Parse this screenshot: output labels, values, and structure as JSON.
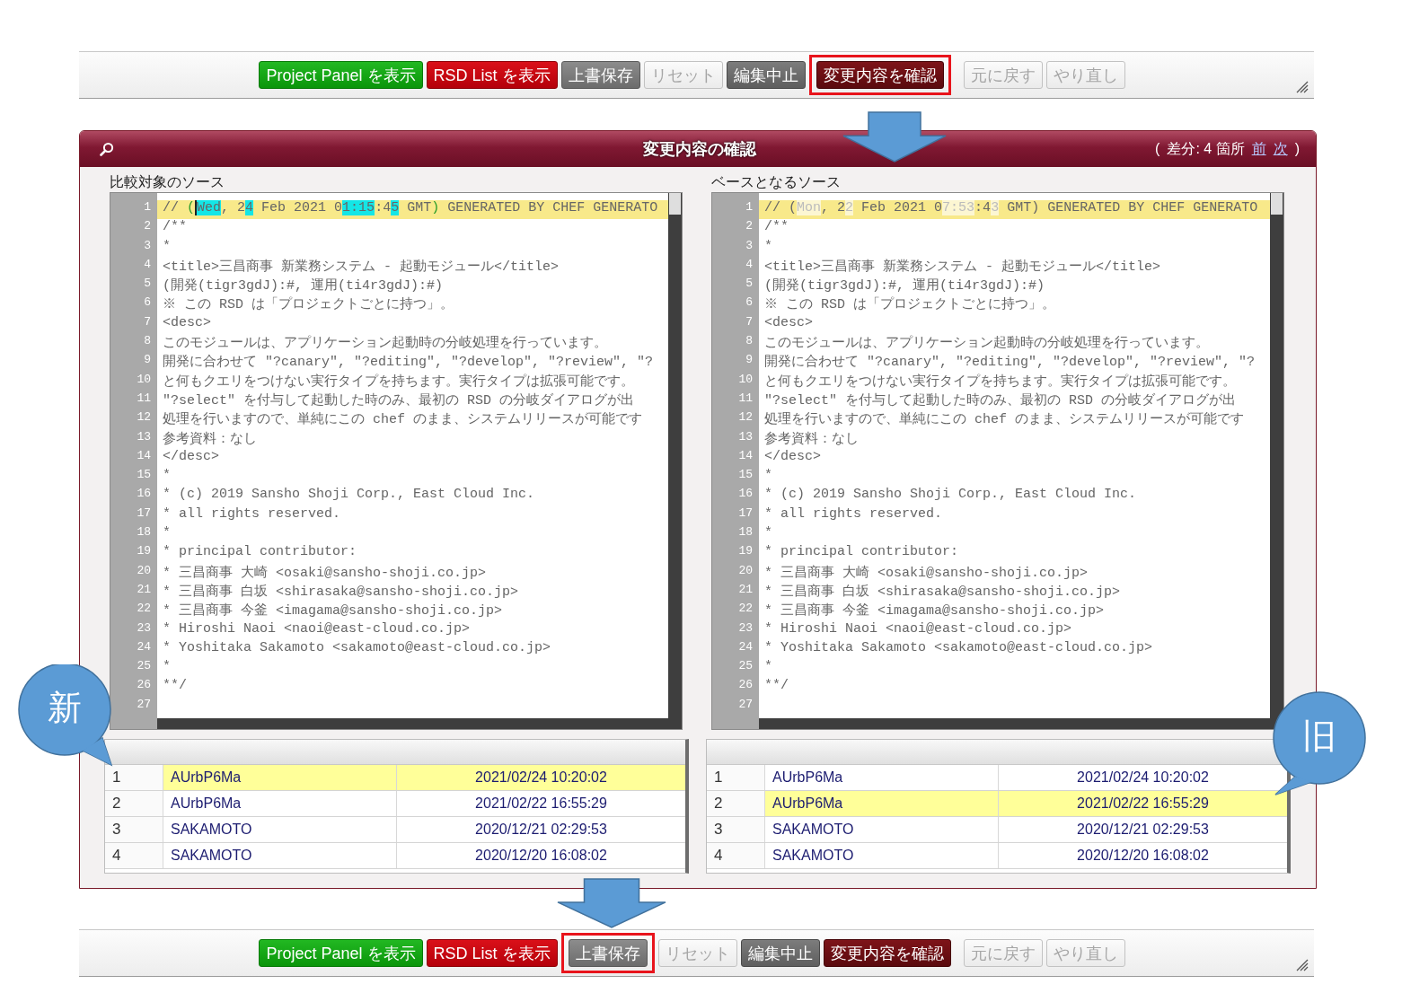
{
  "top_toolbar": {
    "groups": [
      {
        "buttons": [
          {
            "label": "Project Panel を表示",
            "kind": "success",
            "disabled": false,
            "highlighted": false
          },
          {
            "label": "RSD List を表示",
            "kind": "danger",
            "disabled": false,
            "highlighted": false
          },
          {
            "label": "上書保存",
            "kind": "secondary",
            "disabled": false,
            "highlighted": false
          },
          {
            "label": "リセット",
            "kind": "plain",
            "disabled": true,
            "highlighted": false
          },
          {
            "label": "編集中止",
            "kind": "dark",
            "disabled": false,
            "highlighted": false
          },
          {
            "label": "変更内容を確認",
            "kind": "maroon",
            "disabled": false,
            "highlighted": true
          }
        ]
      },
      {
        "buttons": [
          {
            "label": "元に戻す",
            "kind": "plain",
            "disabled": true,
            "highlighted": false
          },
          {
            "label": "やり直し",
            "kind": "plain",
            "disabled": true,
            "highlighted": false
          }
        ]
      }
    ]
  },
  "dialog": {
    "title": "変更内容の確認",
    "diff": {
      "open": "(",
      "count": "差分: 4 箇所",
      "prev": "前",
      "next": "次",
      "close": ")"
    },
    "panes": [
      {
        "label": "比較対象のソース",
        "lines": [
          {
            "number": "1",
            "changed": true,
            "segments": [
              {
                "text": "// ",
                "kind": "same",
                "caret": false
              },
              {
                "text": "(",
                "kind": "bracket",
                "caret": false
              },
              {
                "text": "Wed",
                "kind": "inserted",
                "caret": true
              },
              {
                "text": ", 2",
                "kind": "same",
                "caret": false
              },
              {
                "text": "4",
                "kind": "inserted",
                "caret": false
              },
              {
                "text": " Feb 2021 0",
                "kind": "same",
                "caret": false
              },
              {
                "text": "1:15",
                "kind": "inserted",
                "caret": false
              },
              {
                "text": ":4",
                "kind": "same",
                "caret": false
              },
              {
                "text": "5",
                "kind": "inserted",
                "caret": false
              },
              {
                "text": " GMT",
                "kind": "same",
                "caret": false
              },
              {
                "text": ")",
                "kind": "bracket",
                "caret": false
              },
              {
                "text": " GENERATED BY CHEF GENERATO",
                "kind": "same",
                "caret": false
              }
            ]
          },
          {
            "number": "2",
            "changed": false,
            "text": "/**"
          },
          {
            "number": "3",
            "changed": false,
            "text": "*"
          },
          {
            "number": "4",
            "changed": false,
            "text": "<title>三昌商事 新業務システム - 起動モジュール</title>"
          },
          {
            "number": "5",
            "changed": false,
            "text": "(開発(tigr3gdJ):#, 運用(ti4r3gdJ):#)"
          },
          {
            "number": "6",
            "changed": false,
            "text": "※ この RSD は「プロジェクトごとに持つ」。"
          },
          {
            "number": "7",
            "changed": false,
            "text": "<desc>"
          },
          {
            "number": "8",
            "changed": false,
            "text": "このモジュールは、アプリケーション起動時の分岐処理を行っています。"
          },
          {
            "number": "9",
            "changed": false,
            "text": "開発に合わせて \"?canary\", \"?editing\", \"?develop\", \"?review\", \"?"
          },
          {
            "number": "10",
            "changed": false,
            "text": "と何もクエリをつけない実行タイプを持ちます。実行タイプは拡張可能です。"
          },
          {
            "number": "11",
            "changed": false,
            "text": "\"?select\" を付与して起動した時のみ、最初の RSD の分岐ダイアログが出"
          },
          {
            "number": "12",
            "changed": false,
            "text": "処理を行いますので、単純にこの chef のまま、システムリリースが可能です"
          },
          {
            "number": "13",
            "changed": false,
            "text": "参考資料：なし"
          },
          {
            "number": "14",
            "changed": false,
            "text": "</desc>"
          },
          {
            "number": "15",
            "changed": false,
            "text": "*"
          },
          {
            "number": "16",
            "changed": false,
            "text": "* (c) 2019 Sansho Shoji Corp., East Cloud Inc."
          },
          {
            "number": "17",
            "changed": false,
            "text": "* all rights reserved."
          },
          {
            "number": "18",
            "changed": false,
            "text": "*"
          },
          {
            "number": "19",
            "changed": false,
            "text": "* principal contributor:"
          },
          {
            "number": "20",
            "changed": false,
            "text": "* 三昌商事 大崎 <osaki@sansho-shoji.co.jp>"
          },
          {
            "number": "21",
            "changed": false,
            "text": "* 三昌商事 白坂 <shirasaka@sansho-shoji.co.jp>"
          },
          {
            "number": "22",
            "changed": false,
            "text": "* 三昌商事 今釜 <imagama@sansho-shoji.co.jp>"
          },
          {
            "number": "23",
            "changed": false,
            "text": "* Hiroshi Naoi <naoi@east-cloud.co.jp>"
          },
          {
            "number": "24",
            "changed": false,
            "text": "* Yoshitaka Sakamoto <sakamoto@east-cloud.co.jp>"
          },
          {
            "number": "25",
            "changed": false,
            "text": "*"
          },
          {
            "number": "26",
            "changed": false,
            "text": "**/"
          },
          {
            "number": "27",
            "changed": false
          }
        ],
        "history": [
          {
            "number": "1",
            "user": "AUrbP6Ma",
            "date": "2021/02/24 10:20:02",
            "selected": true
          },
          {
            "number": "2",
            "user": "AUrbP6Ma",
            "date": "2021/02/22 16:55:29",
            "selected": false
          },
          {
            "number": "3",
            "user": "SAKAMOTO",
            "date": "2020/12/21 02:29:53",
            "selected": false
          },
          {
            "number": "4",
            "user": "SAKAMOTO",
            "date": "2020/12/20 16:08:02",
            "selected": false
          }
        ]
      },
      {
        "label": "ベースとなるソース",
        "lines": [
          {
            "number": "1",
            "changed": true,
            "segments": [
              {
                "text": "// (",
                "kind": "same",
                "caret": false
              },
              {
                "text": "Mon",
                "kind": "deleted",
                "caret": false
              },
              {
                "text": ", 2",
                "kind": "same",
                "caret": false
              },
              {
                "text": "2",
                "kind": "deleted",
                "caret": false
              },
              {
                "text": " Feb 2021 0",
                "kind": "same",
                "caret": false
              },
              {
                "text": "7:53",
                "kind": "deleted",
                "caret": false
              },
              {
                "text": ":4",
                "kind": "same",
                "caret": false
              },
              {
                "text": "3",
                "kind": "deleted",
                "caret": false
              },
              {
                "text": " GMT) GENERATED BY CHEF GENERATO",
                "kind": "same",
                "caret": false
              }
            ]
          },
          {
            "number": "2",
            "changed": false,
            "text": "/**"
          },
          {
            "number": "3",
            "changed": false,
            "text": "*"
          },
          {
            "number": "4",
            "changed": false,
            "text": "<title>三昌商事 新業務システム - 起動モジュール</title>"
          },
          {
            "number": "5",
            "changed": false,
            "text": "(開発(tigr3gdJ):#, 運用(ti4r3gdJ):#)"
          },
          {
            "number": "6",
            "changed": false,
            "text": "※ この RSD は「プロジェクトごとに持つ」。"
          },
          {
            "number": "7",
            "changed": false,
            "text": "<desc>"
          },
          {
            "number": "8",
            "changed": false,
            "text": "このモジュールは、アプリケーション起動時の分岐処理を行っています。"
          },
          {
            "number": "9",
            "changed": false,
            "text": "開発に合わせて \"?canary\", \"?editing\", \"?develop\", \"?review\", \"?"
          },
          {
            "number": "10",
            "changed": false,
            "text": "と何もクエリをつけない実行タイプを持ちます。実行タイプは拡張可能です。"
          },
          {
            "number": "11",
            "changed": false,
            "text": "\"?select\" を付与して起動した時のみ、最初の RSD の分岐ダイアログが出"
          },
          {
            "number": "12",
            "changed": false,
            "text": "処理を行いますので、単純にこの chef のまま、システムリリースが可能です"
          },
          {
            "number": "13",
            "changed": false,
            "text": "参考資料：なし"
          },
          {
            "number": "14",
            "changed": false,
            "text": "</desc>"
          },
          {
            "number": "15",
            "changed": false,
            "text": "*"
          },
          {
            "number": "16",
            "changed": false,
            "text": "* (c) 2019 Sansho Shoji Corp., East Cloud Inc."
          },
          {
            "number": "17",
            "changed": false,
            "text": "* all rights reserved."
          },
          {
            "number": "18",
            "changed": false,
            "text": "*"
          },
          {
            "number": "19",
            "changed": false,
            "text": "* principal contributor:"
          },
          {
            "number": "20",
            "changed": false,
            "text": "* 三昌商事 大崎 <osaki@sansho-shoji.co.jp>"
          },
          {
            "number": "21",
            "changed": false,
            "text": "* 三昌商事 白坂 <shirasaka@sansho-shoji.co.jp>"
          },
          {
            "number": "22",
            "changed": false,
            "text": "* 三昌商事 今釜 <imagama@sansho-shoji.co.jp>"
          },
          {
            "number": "23",
            "changed": false,
            "text": "* Hiroshi Naoi <naoi@east-cloud.co.jp>"
          },
          {
            "number": "24",
            "changed": false,
            "text": "* Yoshitaka Sakamoto <sakamoto@east-cloud.co.jp>"
          },
          {
            "number": "25",
            "changed": false,
            "text": "*"
          },
          {
            "number": "26",
            "changed": false,
            "text": "**/"
          },
          {
            "number": "27",
            "changed": false
          }
        ],
        "history": [
          {
            "number": "1",
            "user": "AUrbP6Ma",
            "date": "2021/02/24 10:20:02",
            "selected": false
          },
          {
            "number": "2",
            "user": "AUrbP6Ma",
            "date": "2021/02/22 16:55:29",
            "selected": true
          },
          {
            "number": "3",
            "user": "SAKAMOTO",
            "date": "2020/12/21 02:29:53",
            "selected": false
          },
          {
            "number": "4",
            "user": "SAKAMOTO",
            "date": "2020/12/20 16:08:02",
            "selected": false
          }
        ]
      }
    ]
  },
  "callouts": [
    {
      "text": "新"
    },
    {
      "text": "旧"
    }
  ],
  "bottom_toolbar": {
    "groups": [
      {
        "buttons": [
          {
            "label": "Project Panel を表示",
            "kind": "success",
            "disabled": false,
            "highlighted": false
          },
          {
            "label": "RSD List を表示",
            "kind": "danger",
            "disabled": false,
            "highlighted": false
          },
          {
            "label": "上書保存",
            "kind": "secondary",
            "disabled": false,
            "highlighted": true
          },
          {
            "label": "リセット",
            "kind": "plain",
            "disabled": true,
            "highlighted": false
          },
          {
            "label": "編集中止",
            "kind": "dark",
            "disabled": false,
            "highlighted": false
          },
          {
            "label": "変更内容を確認",
            "kind": "maroon",
            "disabled": false,
            "highlighted": false
          }
        ]
      },
      {
        "buttons": [
          {
            "label": "元に戻す",
            "kind": "plain",
            "disabled": true,
            "highlighted": false
          },
          {
            "label": "やり直し",
            "kind": "plain",
            "disabled": true,
            "highlighted": false
          }
        ]
      }
    ]
  }
}
